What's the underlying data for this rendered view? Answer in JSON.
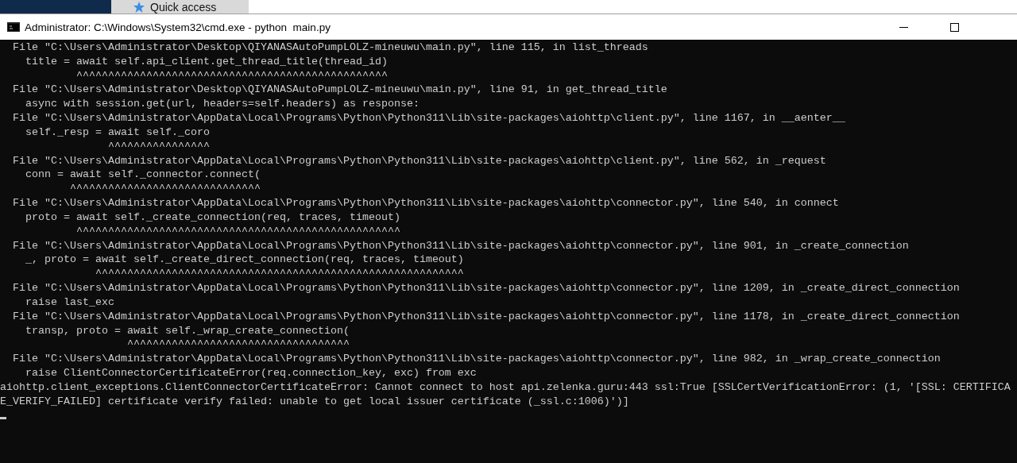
{
  "background_window": {
    "nav_item": "Quick access"
  },
  "window": {
    "title": "Administrator: C:\\Windows\\System32\\cmd.exe - python  main.py"
  },
  "console": {
    "lines": [
      "  File \"C:\\Users\\Administrator\\Desktop\\QIYANASAutoPumpLOLZ-mineuwu\\main.py\", line 115, in list_threads",
      "    title = await self.api_client.get_thread_title(thread_id)",
      "            ^^^^^^^^^^^^^^^^^^^^^^^^^^^^^^^^^^^^^^^^^^^^^^^^^",
      "  File \"C:\\Users\\Administrator\\Desktop\\QIYANASAutoPumpLOLZ-mineuwu\\main.py\", line 91, in get_thread_title",
      "    async with session.get(url, headers=self.headers) as response:",
      "  File \"C:\\Users\\Administrator\\AppData\\Local\\Programs\\Python\\Python311\\Lib\\site-packages\\aiohttp\\client.py\", line 1167, in __aenter__",
      "    self._resp = await self._coro",
      "                 ^^^^^^^^^^^^^^^^",
      "  File \"C:\\Users\\Administrator\\AppData\\Local\\Programs\\Python\\Python311\\Lib\\site-packages\\aiohttp\\client.py\", line 562, in _request",
      "    conn = await self._connector.connect(",
      "           ^^^^^^^^^^^^^^^^^^^^^^^^^^^^^^",
      "  File \"C:\\Users\\Administrator\\AppData\\Local\\Programs\\Python\\Python311\\Lib\\site-packages\\aiohttp\\connector.py\", line 540, in connect",
      "    proto = await self._create_connection(req, traces, timeout)",
      "            ^^^^^^^^^^^^^^^^^^^^^^^^^^^^^^^^^^^^^^^^^^^^^^^^^^^",
      "  File \"C:\\Users\\Administrator\\AppData\\Local\\Programs\\Python\\Python311\\Lib\\site-packages\\aiohttp\\connector.py\", line 901, in _create_connection",
      "    _, proto = await self._create_direct_connection(req, traces, timeout)",
      "               ^^^^^^^^^^^^^^^^^^^^^^^^^^^^^^^^^^^^^^^^^^^^^^^^^^^^^^^^^^",
      "  File \"C:\\Users\\Administrator\\AppData\\Local\\Programs\\Python\\Python311\\Lib\\site-packages\\aiohttp\\connector.py\", line 1209, in _create_direct_connection",
      "    raise last_exc",
      "  File \"C:\\Users\\Administrator\\AppData\\Local\\Programs\\Python\\Python311\\Lib\\site-packages\\aiohttp\\connector.py\", line 1178, in _create_direct_connection",
      "    transp, proto = await self._wrap_create_connection(",
      "                    ^^^^^^^^^^^^^^^^^^^^^^^^^^^^^^^^^^^",
      "  File \"C:\\Users\\Administrator\\AppData\\Local\\Programs\\Python\\Python311\\Lib\\site-packages\\aiohttp\\connector.py\", line 982, in _wrap_create_connection",
      "    raise ClientConnectorCertificateError(req.connection_key, exc) from exc",
      "aiohttp.client_exceptions.ClientConnectorCertificateError: Cannot connect to host api.zelenka.guru:443 ssl:True [SSLCertVerificationError: (1, '[SSL: CERTIFICA",
      "E_VERIFY_FAILED] certificate verify failed: unable to get local issuer certificate (_ssl.c:1006)')]"
    ]
  }
}
